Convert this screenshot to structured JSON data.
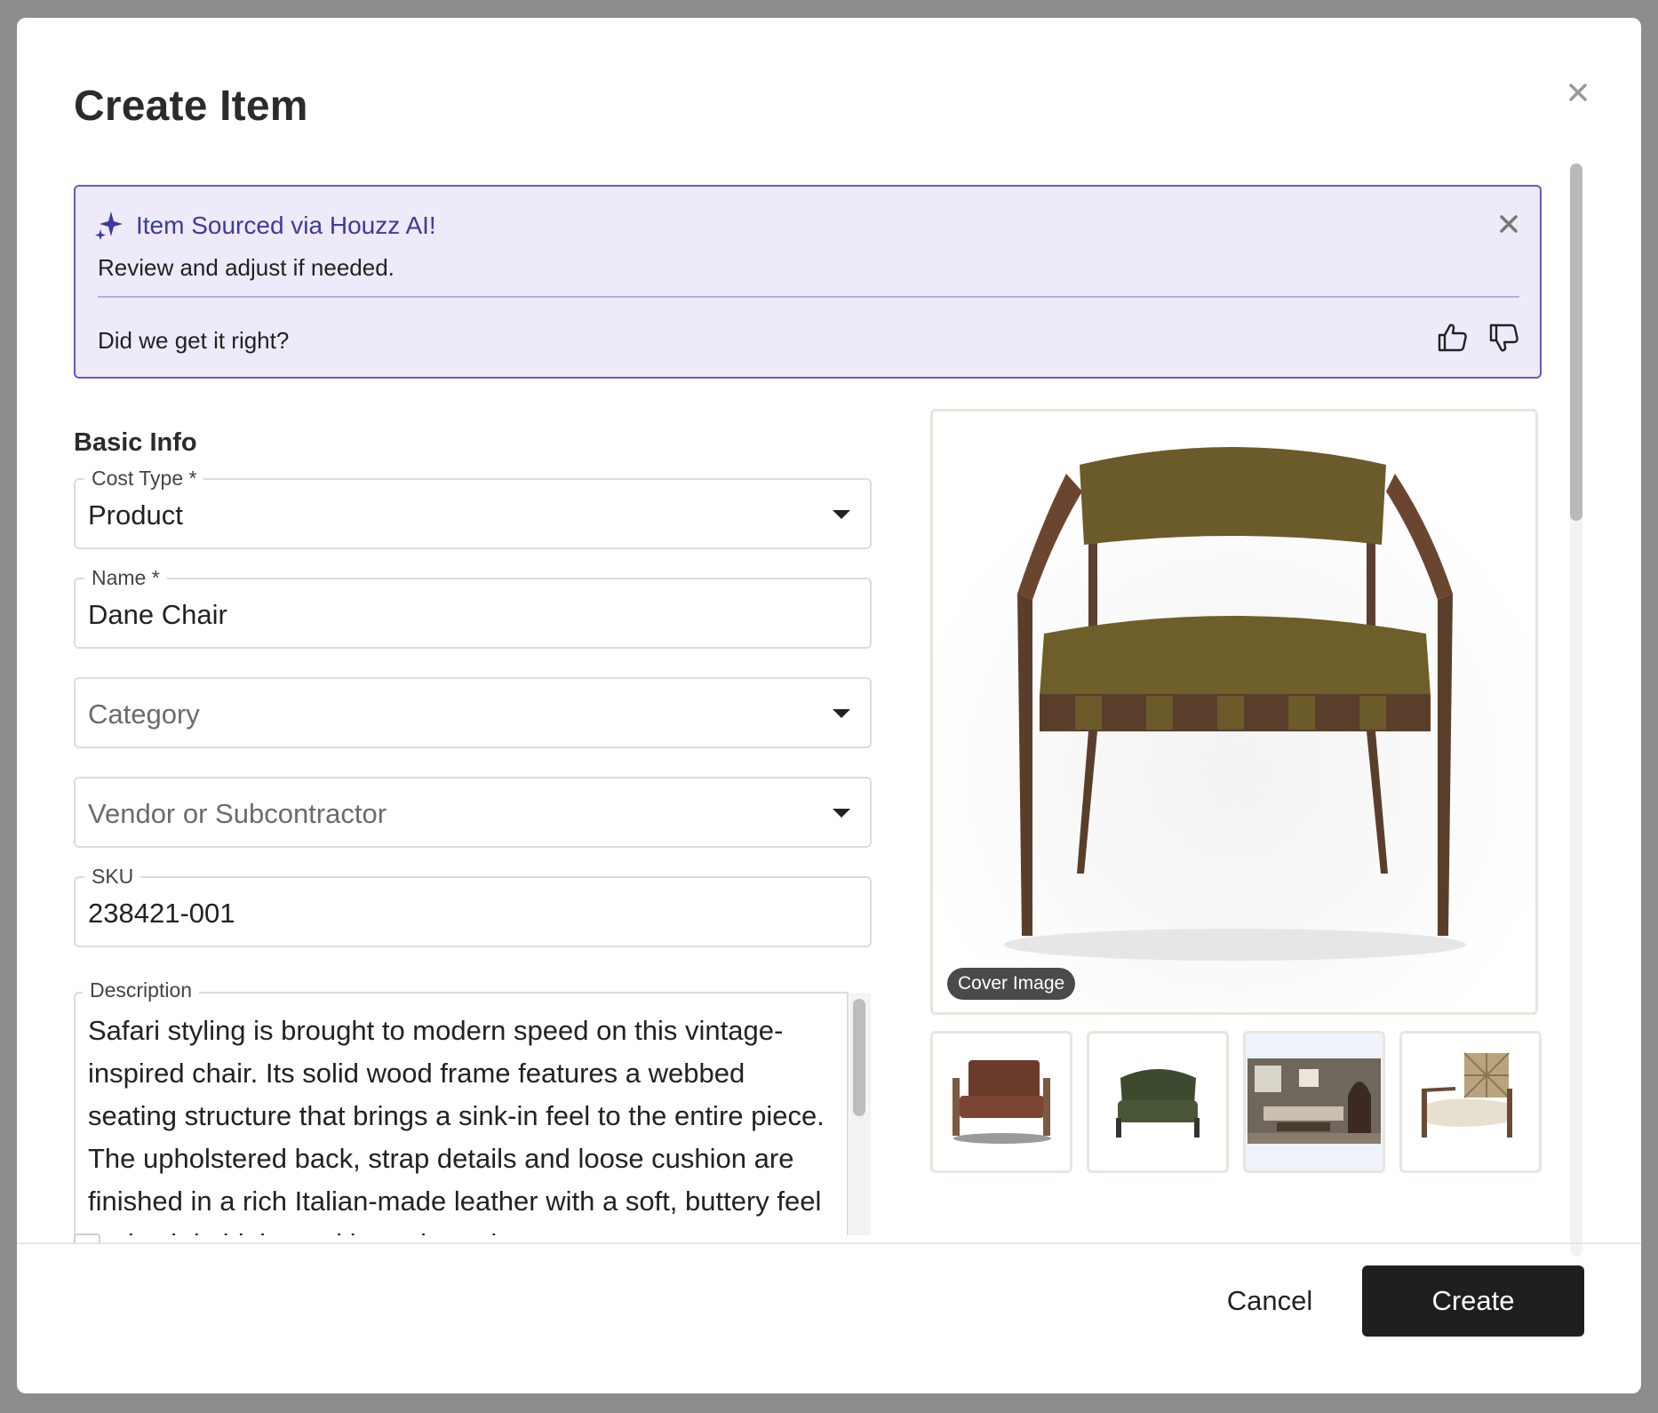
{
  "modal": {
    "title": "Create Item"
  },
  "ai_banner": {
    "title": "Item Sourced via Houzz AI!",
    "subtitle": "Review and adjust if needed.",
    "question": "Did we get it right?"
  },
  "basic_info": {
    "section_title": "Basic Info",
    "cost_type": {
      "label": "Cost Type *",
      "value": "Product"
    },
    "name": {
      "label": "Name *",
      "value": "Dane Chair"
    },
    "category": {
      "placeholder": "Category"
    },
    "vendor": {
      "placeholder": "Vendor or Subcontractor"
    },
    "sku": {
      "label": "SKU",
      "value": "238421-001"
    },
    "description": {
      "label": "Description",
      "value": "Safari styling is brought to modern speed on this vintage-inspired chair. Its solid wood frame features a webbed seating structure that brings a sink-in feel to the entire piece. The upholstered back, strap details and loose cushion are finished in a rich Italian-made leather with a soft, buttery feel and subtle highs and lows throughout."
    }
  },
  "images": {
    "cover_label": "Cover Image",
    "thumbnails": [
      "brown-leather-armchair",
      "green-velvet-armchair",
      "living-room-scene",
      "cane-back-armchair"
    ]
  },
  "footer": {
    "cancel_label": "Cancel",
    "create_label": "Create"
  },
  "colors": {
    "accent_purple": "#6a54c9",
    "banner_bg": "#eeeaf9",
    "primary_button": "#1f1f1f"
  }
}
